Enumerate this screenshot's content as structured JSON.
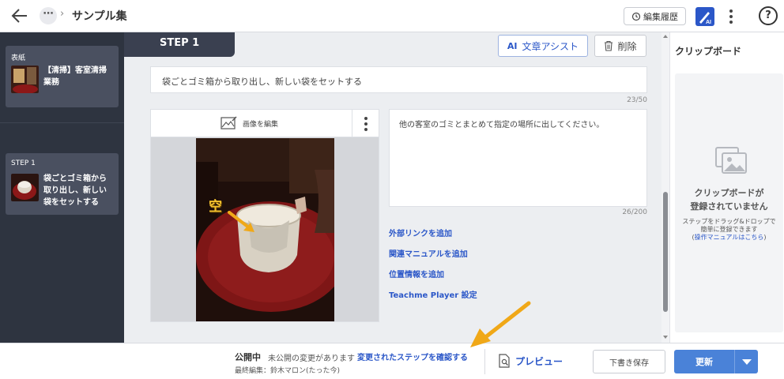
{
  "header": {
    "more_label": "⋯",
    "title": "サンプル集",
    "history_label": "編集履歴",
    "help_label": "?"
  },
  "sidebar": {
    "cover": {
      "label": "表紙",
      "title_line1": "【清掃】客室清掃",
      "title_line2": "業務"
    },
    "step": {
      "label": "STEP 1",
      "title_line1": "袋ごとゴミ箱から",
      "title_line2": "取り出し、新しい",
      "title_line3": "袋をセットする"
    }
  },
  "main": {
    "step_tab": "STEP 1",
    "assist_icon": "AI",
    "assist_label": "文章アシスト",
    "delete_label": "削除",
    "step_title": "袋ごとゴミ箱から取り出し、新しい袋をセットする",
    "title_count": "23/50",
    "edit_image_label": "画像を編集",
    "photo_annotation": "空",
    "description": "他の客室のゴミとまとめて指定の場所に出してください。",
    "description_count": "26/200",
    "links": [
      "外部リンクを追加",
      "関連マニュアルを追加",
      "位置情報を追加",
      "Teachme Player 設定"
    ]
  },
  "clipboard": {
    "title": "クリップボード",
    "empty_line1": "クリップボードが",
    "empty_line2": "登録されていません",
    "hint_line1": "ステップをドラッグ&ドロップで",
    "hint_line2": "簡単に登録できます",
    "hint_paren_open": "(",
    "hint_link": "操作マニュアルはこちら",
    "hint_paren_close": ")"
  },
  "footer": {
    "status": "公開中",
    "note": "未公開の変更があります",
    "link": "変更されたステップを確認する",
    "last_edit": "最終編集：鈴木マロン(たった今)",
    "preview_label": "プレビュー",
    "draft_label": "下書き保存",
    "update_label": "更新"
  },
  "colors": {
    "accent": "#2b57c8",
    "primary_button": "#4a82d8",
    "sidebar_bg": "#2e3440",
    "annotation_arrow": "#f0a818"
  }
}
